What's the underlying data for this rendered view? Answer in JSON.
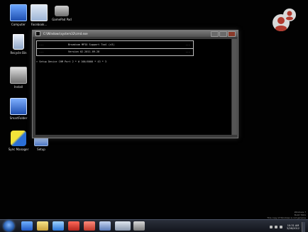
{
  "desktop_icons": [
    {
      "id": "computer",
      "label": "Computer",
      "icon": "computer-icon"
    },
    {
      "id": "facebook",
      "label": "Facebook...",
      "icon": "folder-icon"
    },
    {
      "id": "gamepad",
      "label": "GamePad Pad",
      "icon": "gamepad-icon"
    },
    {
      "id": "recycle-bin",
      "label": "Recycle Bin",
      "icon": "recycle-bin-icon"
    },
    {
      "id": "install",
      "label": "Install",
      "icon": "install-icon"
    },
    {
      "id": "smartfolder",
      "label": "SmartFolder",
      "icon": "folder-icon"
    },
    {
      "id": "sync-manager",
      "label": "Sync Manager",
      "icon": "sync-icon"
    },
    {
      "id": "setup",
      "label": "Setup",
      "icon": "setup-icon"
    }
  ],
  "console": {
    "title": "C:\\Windows\\system32\\cmd.exe",
    "header_rows": [
      {
        "left": "...",
        "middle": "Broadcom MPIO Support Tool (v3)",
        "right": "..."
      },
      {
        "left": "...",
        "middle": "Version 02.2011.09.28",
        "right": "..."
      }
    ],
    "output_line": "> Setup Device CHM Port 2 * # 100/6000 * 43 * 3"
  },
  "watermark": {
    "line1": "Windows 7",
    "line2": "Build 7601",
    "line3": "This copy of Windows is not genuine"
  },
  "taskbar": {
    "items": [
      "ie-icon",
      "explorer-icon",
      "media-player-icon",
      "app-red-icon",
      "app-red-2-icon",
      "network-icon",
      "window-icon",
      "settings-icon"
    ],
    "clock_time": "10:31 AM",
    "clock_date": "3/28/2012"
  }
}
